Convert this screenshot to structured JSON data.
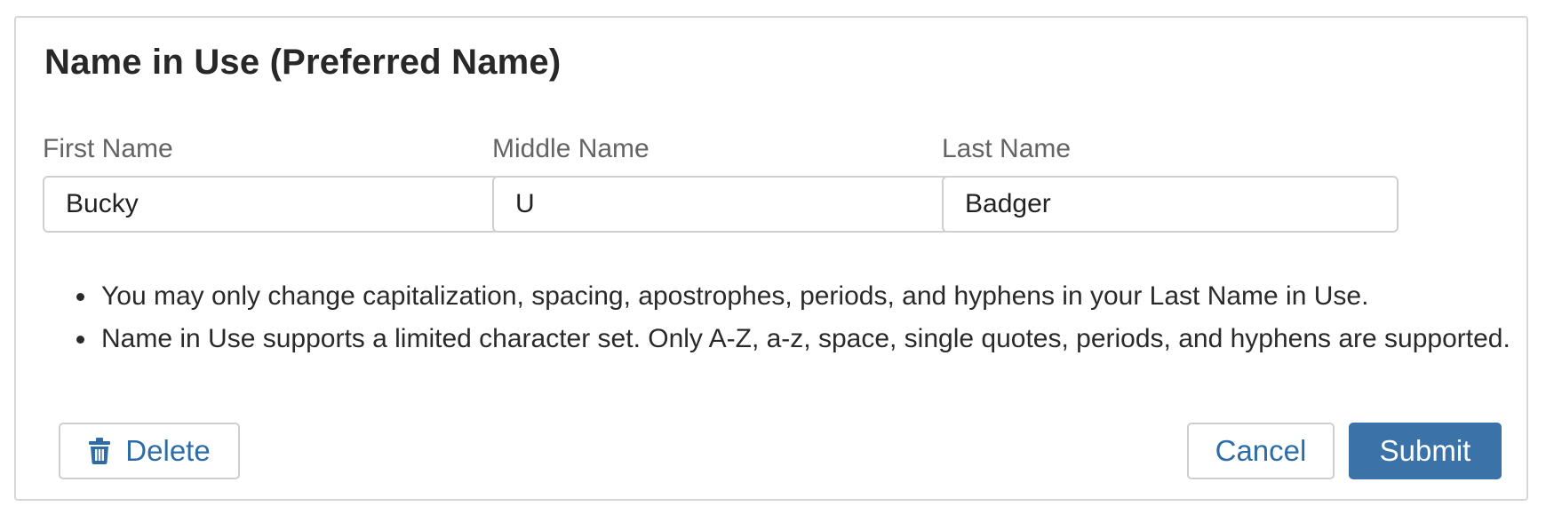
{
  "section": {
    "title": "Name in Use (Preferred Name)"
  },
  "fields": {
    "first": {
      "label": "First Name",
      "value": "Bucky"
    },
    "middle": {
      "label": "Middle Name",
      "value": "U"
    },
    "last": {
      "label": "Last Name",
      "value": "Badger"
    }
  },
  "notes": [
    "You may only change capitalization, spacing, apostrophes, periods, and hyphens in your Last Name in Use.",
    "Name in Use supports a limited character set. Only A-Z, a-z, space, single quotes, periods, and hyphens are supported."
  ],
  "actions": {
    "delete_label": "Delete",
    "delete_icon": "trash-icon",
    "cancel_label": "Cancel",
    "submit_label": "Submit"
  },
  "colors": {
    "primary": "#3b73a9",
    "link": "#2d6ca6",
    "border": "#cfcfcf"
  }
}
